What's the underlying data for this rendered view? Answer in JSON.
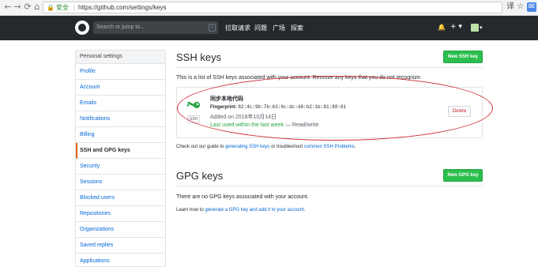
{
  "browser": {
    "secure_label": "安全",
    "url": "https://github.com/settings/keys",
    "back": "←",
    "forward": "→",
    "reload": "⟳",
    "home": "⌂",
    "translate": "译",
    "star": "☆",
    "ext": "✉"
  },
  "header": {
    "search_placeholder": "Search or jump to...",
    "search_key": "/",
    "nav": [
      "拉取请求",
      "问题",
      "广场",
      "探索"
    ],
    "bell": "🔔",
    "plus": "+ ▾",
    "avatar_caret": "▾"
  },
  "sidebar": {
    "heading": "Personal settings",
    "items": [
      {
        "label": "Profile"
      },
      {
        "label": "Account"
      },
      {
        "label": "Emails"
      },
      {
        "label": "Notifications"
      },
      {
        "label": "Billing"
      },
      {
        "label": "SSH and GPG keys"
      },
      {
        "label": "Security"
      },
      {
        "label": "Sessions"
      },
      {
        "label": "Blocked users"
      },
      {
        "label": "Repositories"
      },
      {
        "label": "Organizations"
      },
      {
        "label": "Saved replies"
      },
      {
        "label": "Applications"
      }
    ]
  },
  "ssh": {
    "title": "SSH keys",
    "new_button": "New SSH key",
    "intro": "This is a list of SSH keys associated with your account. Remove any keys that you do not recognize.",
    "key": {
      "title": "同步本地代码",
      "fingerprint_label": "Fingerprint:",
      "fingerprint": "82:4c:9b:7b:63:6c:dc:d6:b2:1b:81:88:61",
      "added": "Added on 2018年10月14日",
      "last_used": "Last used within the last week",
      "access": " — Read/write",
      "badge": "SSH",
      "delete": "Delete"
    },
    "footer_pre": "Check out our guide to ",
    "footer_link1": "generating SSH keys",
    "footer_mid": " or troubleshoot ",
    "footer_link2": "common SSH Problems",
    "footer_end": "."
  },
  "gpg": {
    "title": "GPG keys",
    "new_button": "New GPG key",
    "empty": "There are no GPG keys associated with your account.",
    "learn_pre": "Learn how to ",
    "learn_link": "generate a GPG key and add it to your account",
    "learn_end": "."
  },
  "colors": {
    "header_bg": "#24292e",
    "green_button": "#2cbe4e",
    "link": "#0366d6",
    "last_used": "#28a745",
    "delete_text": "#cb2431",
    "annotation": "#d1323c",
    "selected_marker": "#e36209"
  }
}
